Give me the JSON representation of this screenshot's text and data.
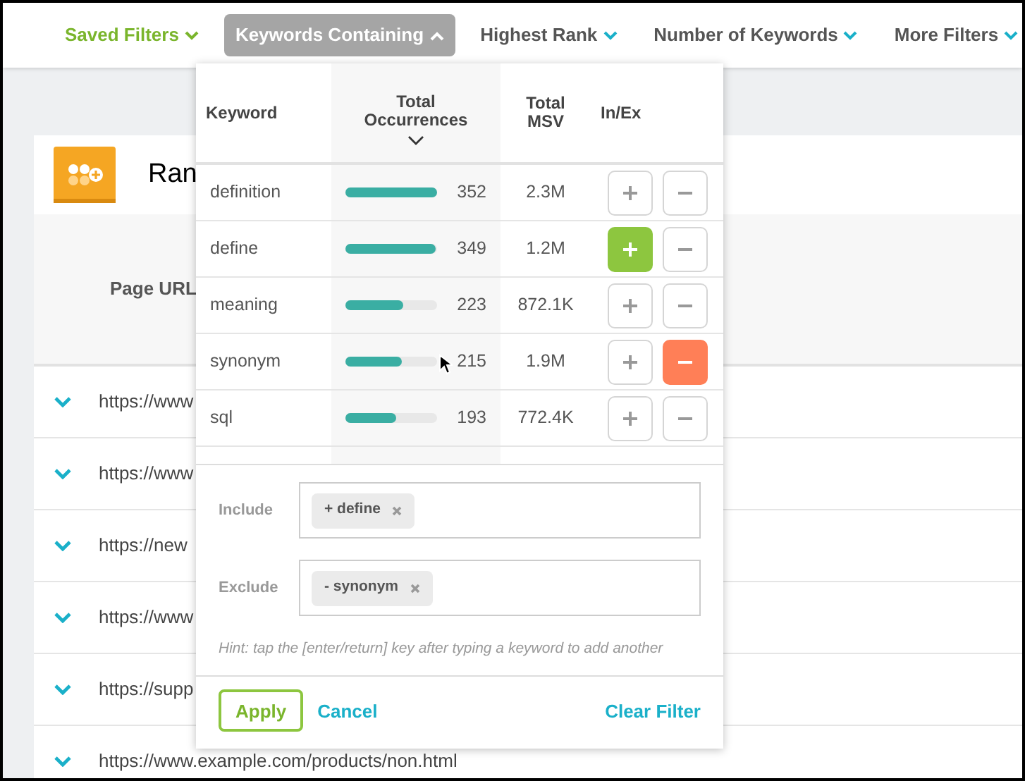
{
  "filter_bar": [
    {
      "label": "Saved Filters",
      "kind": "saved",
      "selected": false
    },
    {
      "label": "Keywords Containing",
      "kind": "filter",
      "selected": true
    },
    {
      "label": "Highest Rank",
      "kind": "filter",
      "selected": false
    },
    {
      "label": "Number of Keywords",
      "kind": "filter",
      "selected": false
    },
    {
      "label": "More Filters",
      "kind": "filter",
      "selected": false
    }
  ],
  "page": {
    "title": "Ran",
    "table_header": "Page URL",
    "rows": [
      "https://www",
      "https://www",
      "https://new",
      "https://www",
      "https://supp",
      "https://www.example.com/products/non.html"
    ]
  },
  "dropdown": {
    "columns": [
      "Keyword",
      "Total Occurrences",
      "Total MSV",
      "In/Ex"
    ],
    "keywords": [
      {
        "keyword": "definition",
        "occurrences": "352",
        "level": 1.0,
        "msv": "2.3M",
        "included": false,
        "excluded": false
      },
      {
        "keyword": "define",
        "occurrences": "349",
        "level": 0.99,
        "msv": "1.2M",
        "included": true,
        "excluded": false
      },
      {
        "keyword": "meaning",
        "occurrences": "223",
        "level": 0.63,
        "msv": "872.1K",
        "included": false,
        "excluded": false
      },
      {
        "keyword": "synonym",
        "occurrences": "215",
        "level": 0.61,
        "msv": "1.9M",
        "included": false,
        "excluded": true
      },
      {
        "keyword": "sql",
        "occurrences": "193",
        "level": 0.55,
        "msv": "772.4K",
        "included": false,
        "excluded": false
      }
    ],
    "include": {
      "label": "Include",
      "tags": [
        "+ define"
      ]
    },
    "exclude": {
      "label": "Exclude",
      "tags": [
        "- synonym"
      ]
    },
    "hint": "Hint: tap the [enter/return] key after typing a keyword to add another",
    "buttons": {
      "apply": "Apply",
      "cancel": "Cancel",
      "clear": "Clear Filter"
    }
  }
}
